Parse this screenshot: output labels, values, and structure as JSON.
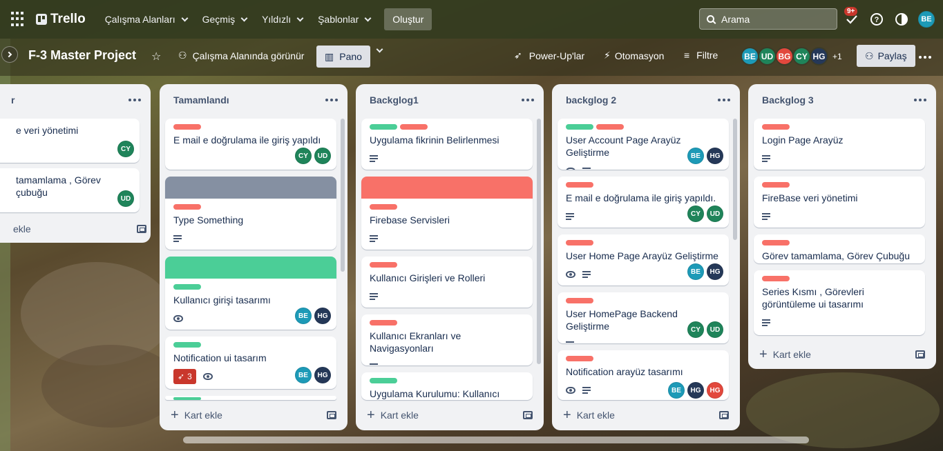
{
  "topbar": {
    "app_name": "Trello",
    "nav": [
      "Çalışma Alanları",
      "Geçmiş",
      "Yıldızlı",
      "Şablonlar"
    ],
    "create": "Oluştur",
    "search_placeholder": "Arama",
    "notification_count": "9+",
    "user_initials": "BE"
  },
  "board": {
    "title": "F-3 Master Project",
    "visibility": "Çalışma Alanında görünür",
    "view": "Pano",
    "powerups": "Power-Up'lar",
    "automation": "Otomasyon",
    "filter": "Filtre",
    "members": [
      {
        "initials": "BE",
        "color": "#1d9ab7"
      },
      {
        "initials": "UD",
        "color": "#1f845a"
      },
      {
        "initials": "BG",
        "color": "#e2483d"
      },
      {
        "initials": "CY",
        "color": "#1f845a"
      },
      {
        "initials": "HG",
        "color": "#253858"
      }
    ],
    "members_more": "+1",
    "share": "Paylaş"
  },
  "colors": {
    "green": "#4bce97",
    "red": "#f87168",
    "gray": "#8590a2",
    "blue": "#1d9ab7",
    "dark": "#253858",
    "teal": "#1f845a"
  },
  "lists": [
    {
      "title": "r",
      "cards": [
        {
          "title": "e veri yönetimi",
          "members": [
            "CY"
          ]
        },
        {
          "title": "tamamlama , Görev çubuğu",
          "members": [
            "UD"
          ]
        }
      ],
      "add": "ekle"
    },
    {
      "title": "Tamamlandı",
      "cards": [
        {
          "title": "E mail e doğrulama ile giriş yapıldı",
          "members": [
            "CY",
            "UD"
          ]
        },
        {
          "title": "Type Something"
        },
        {
          "title": "Kullanıcı girişi tasarımı",
          "members": [
            "BE",
            "HG"
          ]
        },
        {
          "title": "Notification ui tasarım",
          "notif": "3",
          "members": [
            "BE",
            "HG"
          ]
        }
      ],
      "add": "Kart ekle"
    },
    {
      "title": "Backglog1",
      "cards": [
        {
          "title": "Uygulama fikrinin Belirlenmesi"
        },
        {
          "title": "Firebase Servisleri"
        },
        {
          "title": "Kullanıcı Girişleri ve Rolleri"
        },
        {
          "title": "Kullanıcı Ekranları ve Navigasyonları"
        },
        {
          "title": "Uygulama Kurulumu: Kullanıcı"
        }
      ],
      "add": "Kart ekle"
    },
    {
      "title": "backglog 2",
      "cards": [
        {
          "title": "User Account Page Arayüz Geliştirme",
          "members": [
            "BE",
            "HG"
          ]
        },
        {
          "title": "E mail e doğrulama ile giriş yapıldı.",
          "members": [
            "CY",
            "UD"
          ]
        },
        {
          "title": "User Home Page Arayüz Geliştirme",
          "members": [
            "BE",
            "HG"
          ]
        },
        {
          "title": "User HomePage Backend Geliştirme",
          "members": [
            "CY",
            "UD"
          ]
        },
        {
          "title": "Notification arayüz tasarımı",
          "members": [
            "BE",
            "HG",
            "HG"
          ]
        }
      ],
      "add": "Kart ekle"
    },
    {
      "title": "Backglog 3",
      "cards": [
        {
          "title": "Login Page Arayüz"
        },
        {
          "title": "FireBase veri yönetimi"
        },
        {
          "title": "Görev tamamlama, Görev Çubuğu"
        },
        {
          "title": "Series Kısmı , Görevleri görüntüleme ui tasarımı"
        }
      ],
      "add": "Kart ekle"
    }
  ]
}
